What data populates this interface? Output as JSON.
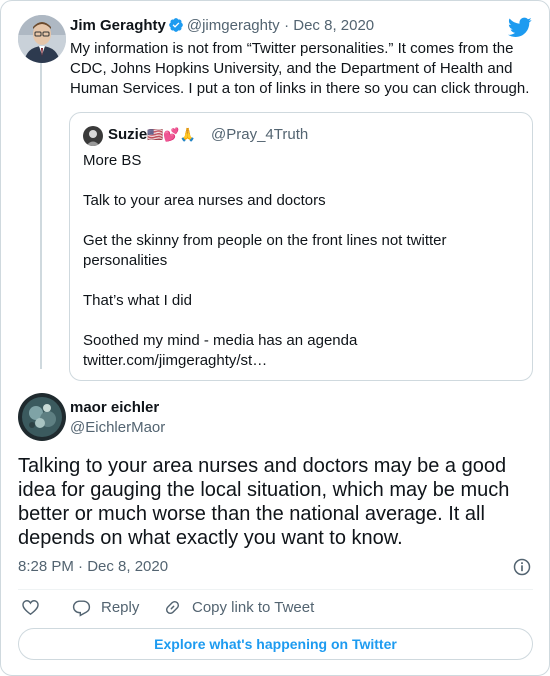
{
  "parent_tweet": {
    "author_name": "Jim Geraghty",
    "author_handle": "@jimgeraghty",
    "date": "· Dec 8, 2020",
    "text": "My information is not from “Twitter personalities.” It comes from the CDC, Johns Hopkins University, and the Department of Health and Human Services. I put a ton of links in there so you can click through.",
    "quoted_tweet": {
      "author_name": "Suzie",
      "author_emoji": "🇺🇸💕🙏",
      "author_handle": "@Pray_4Truth",
      "lines": [
        "More BS",
        "Talk to your area nurses and doctors",
        "Get the skinny from people on the front lines not twitter personalities",
        "That’s what I did",
        "Soothed my mind - media has an agenda"
      ],
      "link": "twitter.com/jimgeraghty/st…"
    }
  },
  "main_tweet": {
    "author_name": "maor eichler",
    "author_handle": "@EichlerMaor",
    "text": "Talking to your area nurses and doctors may be a good idea for gauging the local situation, which may be much better or much worse than the national average. It all depends on what exactly you want to know.",
    "timestamp": "8:28 PM · Dec 8, 2020"
  },
  "actions": {
    "reply_label": "Reply",
    "copy_link_label": "Copy link to Tweet"
  },
  "explore_label": "Explore what's happening on Twitter",
  "colors": {
    "accent": "#1d9bf0",
    "text_primary": "#0f1419",
    "text_secondary": "#536471",
    "border": "#cfd9de"
  },
  "icons": [
    "twitter-bird-icon",
    "verified-badge-icon",
    "info-icon",
    "heart-icon",
    "reply-icon",
    "link-icon"
  ]
}
